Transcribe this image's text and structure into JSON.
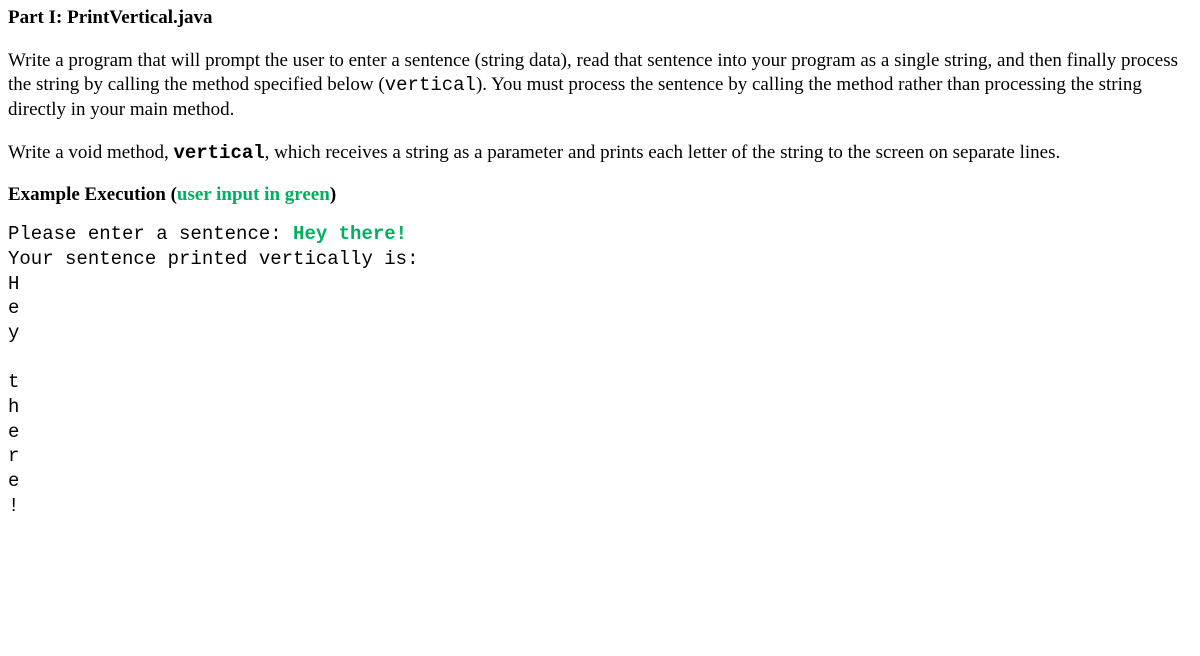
{
  "heading": {
    "part_label": "Part I:  ",
    "filename": "PrintVertical.java"
  },
  "paragraph1": {
    "segment1": "Write a program that will prompt the user to enter a sentence (string data), read that sentence into your program as a single string, and then finally process the string by calling the method specified below (",
    "code1": "vertical",
    "segment2": "). You must process the sentence by calling the method rather than processing the string directly in your main method."
  },
  "paragraph2": {
    "segment1": "Write a void method, ",
    "code1": "vertical",
    "segment2": ", which receives a string as a parameter and prints each letter of the string to the screen on separate lines."
  },
  "example_heading": {
    "label": "Example Execution ",
    "paren_open": "(",
    "green_text": "user input in green",
    "paren_close": ")"
  },
  "execution": {
    "prompt": "Please enter a sentence: ",
    "user_input": "Hey there!",
    "response_label": "Your sentence printed vertically is:",
    "output_lines": [
      "H",
      "e",
      "y",
      "",
      "t",
      "h",
      "e",
      "r",
      "e",
      "!"
    ]
  }
}
